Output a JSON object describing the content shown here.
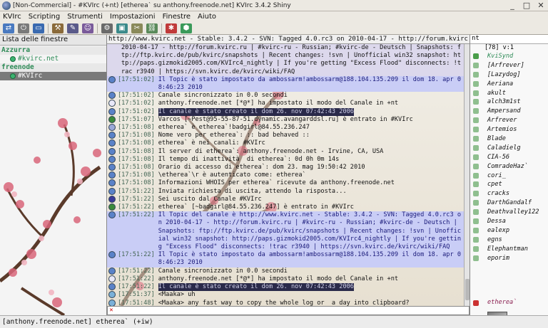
{
  "window": {
    "title": "[Non-Commercial] - #KVIrc (+nt) [etherea` su anthony.freenode.net] KVIrc 3.4.2 Shiny",
    "controls": [
      "_",
      "□",
      "✕"
    ]
  },
  "menu": [
    "KVIrc",
    "Scripting",
    "Strumenti",
    "Impostazioni",
    "Finestre",
    "Aiuto"
  ],
  "toolbar_icons": [
    "server-icon",
    "connect-icon",
    "window-icon",
    "options-icon",
    "script-icon",
    "user-icon",
    "tools-icon",
    "scripting-icon",
    "log-icon",
    "link-icon",
    "settings-icon",
    "help-icon",
    "plugin-icon"
  ],
  "sidebar": {
    "header": "Lista delle finestre",
    "items": [
      {
        "type": "network",
        "label": "Azzurra"
      },
      {
        "type": "channel",
        "label": "#kvirc.net"
      },
      {
        "type": "network",
        "label": "freenode"
      },
      {
        "type": "channel",
        "label": "#KVIrc",
        "active": true
      }
    ]
  },
  "topic_bar": "http://www.kvirc.net - Stable: 3.4.2 - SVN: Tagged 4.0.rc3 on 2010-04-17 - http://forum.kvirc.ru | #kvir",
  "messages": [
    {
      "ts": "",
      "text": "2010-04-17 - http://forum.kvirc.ru | #kvirc-ru - Russian; #kvirc-de - Deutsch | Snapshots: ftp://ftp.kvirc.de/pub/kvirc/snapshots | Recent changes: !svn | Unofficial win32 snapshot: http://paps.gizmokid2005.com/KVIrc4_nightly | If you're getting \"Excess Flood\" disconnects: !trac r3940 | https://svn.kvirc.de/kvirc/wiki/FAQ",
      "style": "alt",
      "icon": ""
    },
    {
      "ts": "[17:51:02]",
      "text": "Il Topic è stato impostato da ambossarm!ambossarm@188.104.135.209 il dom 18. apr 08:46:23 2010",
      "style": "hl",
      "icon": "#5a82c8"
    },
    {
      "ts": "[17:51:02]",
      "text": "Canale sincronizzato in 0.0 secondi",
      "style": "",
      "icon": "#5a82c8"
    },
    {
      "ts": "[17:51:02]",
      "text": "anthony.freenode.net [*@*] ha impostato il modo del Canale in +nt",
      "style": "",
      "icon": "#e8e8f8"
    },
    {
      "ts": "[17:51:02]",
      "text": "Il canale è stato creato il dom 26. nov 07:42:43 2006",
      "style": "dark",
      "icon": "#5a82c8"
    },
    {
      "ts": "[17:51:07]",
      "text": "Varcos [~Pest@95-55-87-51.dynamic.avangarddsl.ru] è entrato in #KVIrc",
      "style": "",
      "icon": "#3a8a3a"
    },
    {
      "ts": "[17:51:08]",
      "text": "etherea` è etherea`!badgirl@84.55.236.247",
      "style": "",
      "icon": "#9aa8d8"
    },
    {
      "ts": "[17:51:08]",
      "text": "Nome vero per etherea`: :: bad behaved ::",
      "style": "",
      "icon": "#5a82c8"
    },
    {
      "ts": "[17:51:08]",
      "text": "etherea` è nei canali: #KVIrc",
      "style": "",
      "icon": "#5a82c8"
    },
    {
      "ts": "[17:51:08]",
      "text": "Il server di etherea`: anthony.freenode.net - Irvine, CA, USA",
      "style": "",
      "icon": "#5a82c8"
    },
    {
      "ts": "[17:51:08]",
      "text": "Il tempo di inattività  di etherea`: 0d 0h 0m 14s",
      "style": "",
      "icon": "#5a82c8"
    },
    {
      "ts": "[17:51:08]",
      "text": "Orario di accesso di etherea`: dom 23. mag 19:50:42 2010",
      "style": "",
      "icon": "#5a82c8"
    },
    {
      "ts": "[17:51:08]",
      "text": "\\etherea`\\r è autenticato come: etherea`",
      "style": "",
      "icon": "#5a82c8"
    },
    {
      "ts": "[17:51:08]",
      "text": "Informazioni WHOIS per etherea` ricevute da anthony.freenode.net",
      "style": "",
      "icon": "#5a82c8"
    },
    {
      "ts": "[17:51:22]",
      "text": "Inviata richiesta di uscita, attendo la risposta...",
      "style": "",
      "icon": "#5a82c8"
    },
    {
      "ts": "[17:51:22]",
      "text": "Sei uscito dal Canale #KVIrc",
      "style": "",
      "icon": "#3a3a9a"
    },
    {
      "ts": "[17:51:22]",
      "text": "etherea` [~badgirl@84.55.236.247] è entrato in #KVIrc",
      "style": "",
      "icon": "#3a8a3a"
    },
    {
      "ts": "[17:51:22]",
      "text": "Il Topic del canale è http://www.kvirc.net - Stable: 3.4.2 - SVN: Tagged 4.0.rc3 on 2010-04-17 - http://forum.kvirc.ru | #kvirc-ru - Russian; #kvirc-de - Deutsch | Snapshots: ftp://ftp.kvirc.de/pub/kvirc/snapshots | Recent changes: !svn | Unofficial win32 snapshot: http://paps.gizmokid2005.com/KVIrc4_nightly | If you're getting \"Excess Flood\" disconnects: !trac r3940 | https://svn.kvirc.de/kvirc/wiki/FAQ",
      "style": "hl",
      "icon": "#5a82c8"
    },
    {
      "ts": "[17:51:22]",
      "text": "Il Topic è stato impostato da ambossarm!ambossarm@188.104.135.209 il dom 18. apr 08:46:23 2010",
      "style": "hl",
      "icon": "#5a82c8"
    },
    {
      "ts": "[17:51:22]",
      "text": "Canale sincronizzato in 0.0 secondi",
      "style": "",
      "icon": "#5a82c8"
    },
    {
      "ts": "[17:51:22]",
      "text": "anthony.freenode.net [*@*] ha impostato il modo del Canale in +nt",
      "style": "",
      "icon": "#e8e8f8"
    },
    {
      "ts": "[17:51:22]",
      "text": "Il canale è stato creato il dom 26. nov 07:42:43 2006",
      "style": "dark",
      "icon": "#5a82c8"
    },
    {
      "ts": "[17:51:37]",
      "text": "<Maaka> uh",
      "style": "",
      "icon": "#7ab0d8"
    },
    {
      "ts": "[17:51:48]",
      "text": "<Maaka> any fast way to copy the whole log or  a day into clipboard?",
      "style": "",
      "icon": "#7ab0d8"
    },
    {
      "ts": "[17:51:57]",
      "text": "<Maaka> so without having to scroll fro minutes xD",
      "style": "",
      "icon": "#7ab0d8"
    }
  ],
  "users": {
    "search": "nt",
    "count": "[78]  v:1",
    "list": [
      {
        "nick": "KviSynd",
        "op": true
      },
      {
        "nick": "[Arfrever]"
      },
      {
        "nick": "[Lazydog]"
      },
      {
        "nick": "Aeriana"
      },
      {
        "nick": "akult"
      },
      {
        "nick": "alch3m1st"
      },
      {
        "nick": "Ampersand"
      },
      {
        "nick": "Arfrever"
      },
      {
        "nick": "Artemios"
      },
      {
        "nick": "Blade"
      },
      {
        "nick": "Caladielg"
      },
      {
        "nick": "CIA-56"
      },
      {
        "nick": "ComradeHaz`"
      },
      {
        "nick": "cori_"
      },
      {
        "nick": "cpet"
      },
      {
        "nick": "cracks"
      },
      {
        "nick": "DarthGandalf"
      },
      {
        "nick": "Deathvalley122"
      },
      {
        "nick": "Dessa"
      },
      {
        "nick": "ealexp"
      },
      {
        "nick": "egns"
      },
      {
        "nick": "Elephantman"
      },
      {
        "nick": "eporim"
      }
    ],
    "me": "etherea`"
  },
  "status_bar": "[anthony.freenode.net] etherea` (+iw)"
}
